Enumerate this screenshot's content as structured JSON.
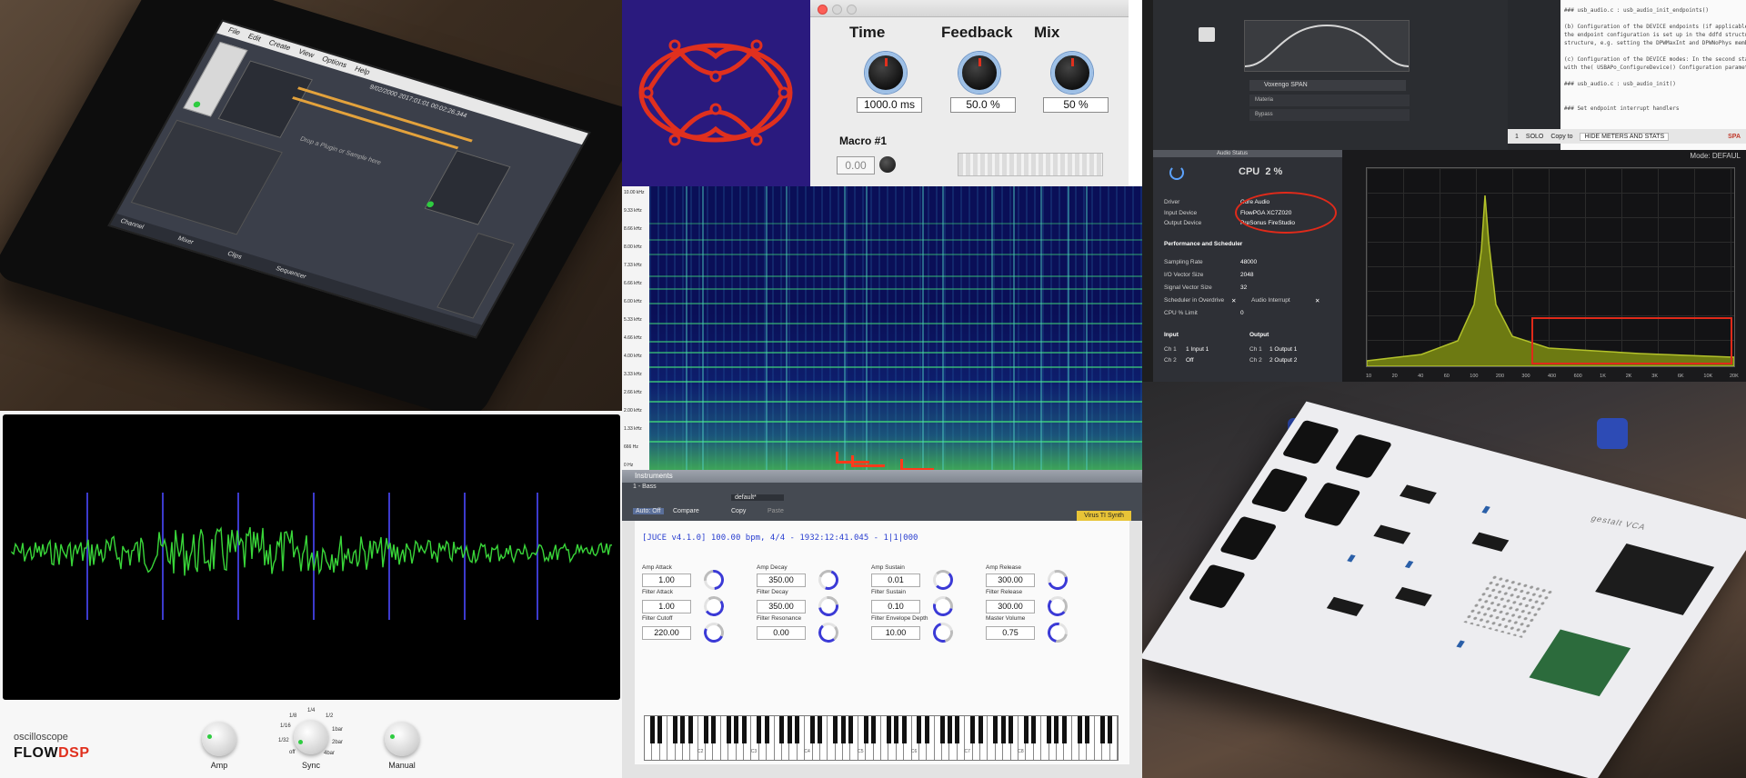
{
  "tablet": {
    "menu": [
      "File",
      "Edit",
      "Create",
      "View",
      "Options",
      "Help"
    ],
    "info": "9/02/2000 2017:01:01   00:02:26.344",
    "hint": "Drop a Plugin or Sample here",
    "tabs": [
      "Channel",
      "Mixer",
      "Clips",
      "Sequencer"
    ]
  },
  "delay": {
    "time_label": "Time",
    "feedback_label": "Feedback",
    "mix_label": "Mix",
    "time_value": "1000.0 ms",
    "feedback_value": "50.0 %",
    "mix_value": "50 %",
    "macro_label": "Macro #1",
    "macro_value": "0.00"
  },
  "spectrogram": {
    "freq_ticks": [
      "10.00 kHz",
      "9.33 kHz",
      "8.66 kHz",
      "8.00 kHz",
      "7.33 kHz",
      "6.66 kHz",
      "6.00 kHz",
      "5.33 kHz",
      "4.66 kHz",
      "4.00 kHz",
      "3.33 kHz",
      "2.66 kHz",
      "2.00 kHz",
      "1.33 kHz",
      "666 Hz",
      "0 Hz"
    ]
  },
  "rack": {
    "plugin_title": "Voxengo SPAN",
    "rows": [
      "Materia",
      "Bypass"
    ],
    "code_lines": [
      "### usb_audio.c : usb_audio_init_endpoints()",
      "",
      "(b) Configuration of the DEVICE endpoints (if applicable) If DEVI",
      "the endpoint configuration is set up in the ddfd structure, The wh",
      "structure, e.g. setting the DPWMaxInt and DPWNoPhys members.",
      "",
      "(c) Configuration of the DEVICE modes: In the second stage the poi",
      "with the( USBAPo_ConfigureDevice() Configuration parameters are de",
      "",
      "### usb_audio.c : usb_audio_init()",
      "",
      "",
      "### Set endpoint interrupt handlers"
    ],
    "footer": [
      "1",
      "SOLO",
      "Copy to",
      "HIDE METERS AND STATS",
      "SPA"
    ],
    "plot_mode_label": "Mode:",
    "plot_mode_value": "DEFAUL"
  },
  "audio_status": {
    "title": "Audio Status",
    "cpu_label": "CPU",
    "cpu_value": "2 %",
    "driver_label": "Driver",
    "driver_value": "Core Audio",
    "input_device_label": "Input Device",
    "input_device_value": "FlowPGA XC7Z020",
    "output_device_label": "Output Device",
    "output_device_value": "PreSonus FireStudio",
    "perf_section": "Performance and Scheduler",
    "sampling_rate_label": "Sampling Rate",
    "sampling_rate_value": "48000",
    "io_vector_label": "I/O Vector Size",
    "io_vector_value": "2048",
    "signal_vector_label": "Signal Vector Size",
    "signal_vector_value": "32",
    "overdrive_label": "Scheduler in Overdrive",
    "audio_interrupt_label": "Audio Interrupt",
    "cpu_limit_label": "CPU % Limit",
    "cpu_limit_value": "0",
    "input_section": "Input",
    "output_section": "Output",
    "ch1_label": "Ch 1",
    "ch2_label": "Ch 2",
    "in_ch1": "1 Input 1",
    "in_ch2": "Off",
    "out_ch1": "1 Output 1",
    "out_ch2": "2 Output 2"
  },
  "spectrum_xticks": [
    "10",
    "20",
    "40",
    "60",
    "100",
    "200",
    "300",
    "400",
    "600",
    "1K",
    "2K",
    "3K",
    "6K",
    "10K",
    "20K"
  ],
  "oscilloscope": {
    "subtitle": "oscilloscope",
    "brand_flow": "FLOW",
    "brand_dsp": "DSP",
    "amp_label": "Amp",
    "sync_label": "Sync",
    "manual_label": "Manual",
    "sync_options": [
      "1/4",
      "1/8",
      "1/2",
      "1/16",
      "1bar",
      "1/32",
      "2bar",
      "off",
      "4bar"
    ]
  },
  "juce": {
    "window_title": "Instruments",
    "track": "1 - Bass",
    "preset": "default*",
    "auto": "Auto: Off",
    "compare": "Compare",
    "copy": "Copy",
    "paste": "Paste",
    "synth_tag": "Virus TI Synth",
    "header": "[JUCE v4.1.0]   100.00 bpm, 4/4  - 1932:12:41.045  - 1|1|000",
    "params": [
      {
        "top": "Amp Attack",
        "bottom": "Filter Attack",
        "v1": "1.00",
        "v2": "1.00",
        "v3": "220.00"
      },
      {
        "top": "Amp Decay",
        "bottom": "Filter Decay",
        "v1": "350.00",
        "v2": "350.00",
        "v3": "0.00"
      },
      {
        "top": "Amp Sustain",
        "bottom": "Filter Sustain",
        "v1": "0.01",
        "v2": "0.10",
        "v3": "10.00"
      },
      {
        "top": "Amp Release",
        "bottom": "Filter Release",
        "v1": "300.00",
        "v2": "300.00",
        "v3": "0.75"
      }
    ],
    "row2_labels": [
      "Filter Cutoff",
      "Filter Resonance",
      "Filter Envelope Depth",
      "Master Volume"
    ],
    "octaves": [
      "C2",
      "C3",
      "C4",
      "C5",
      "C6",
      "C7",
      "C8"
    ]
  },
  "pcb": {
    "silkscreen": "gestalt VCA"
  },
  "colors": {
    "logo_bg": "#2a1a7e",
    "logo_stroke": "#e0301e",
    "scope_trace": "#39d639",
    "accent_blue": "#3b3ad6",
    "annotation_red": "#e02a1a"
  }
}
